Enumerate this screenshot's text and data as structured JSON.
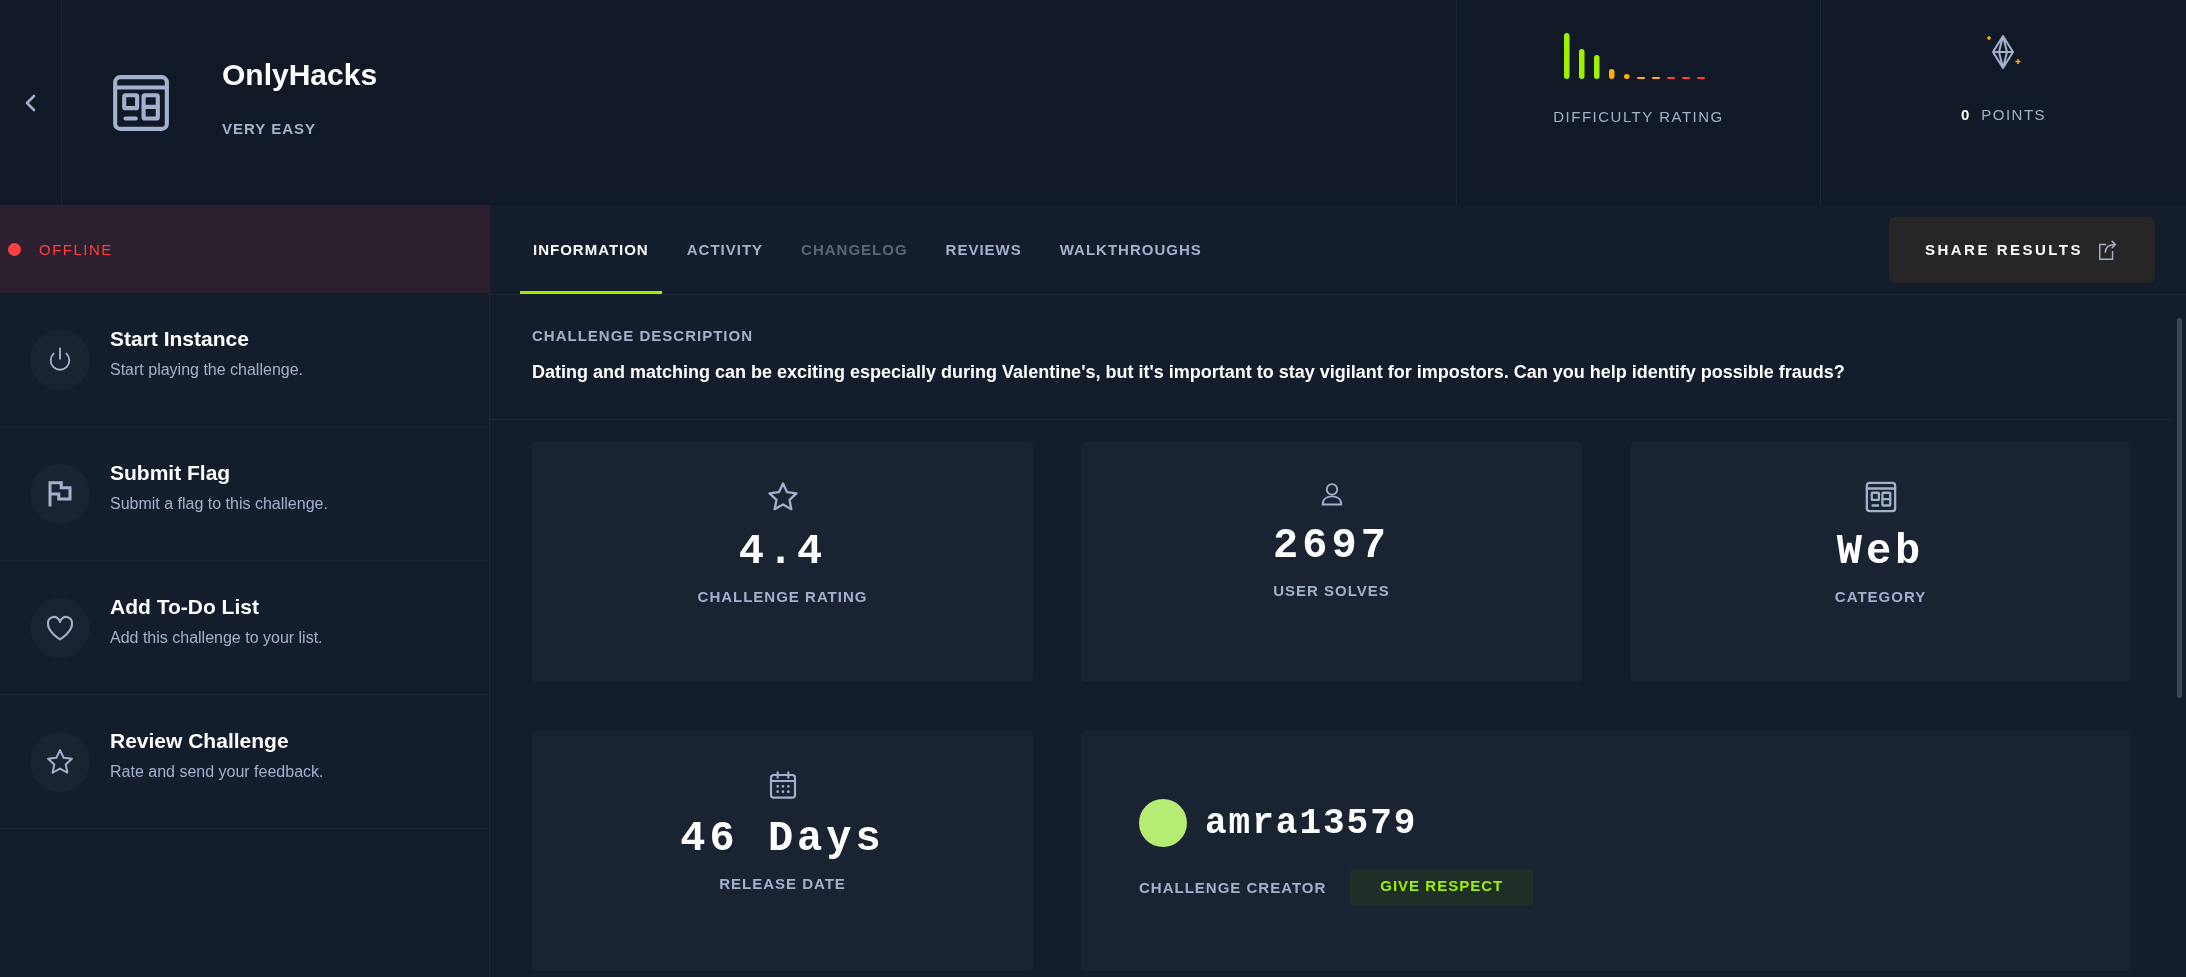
{
  "header": {
    "title": "OnlyHacks",
    "difficulty": "VERY EASY",
    "difficulty_label": "DIFFICULTY RATING",
    "points_value": "0",
    "points_label": "POINTS"
  },
  "status": {
    "label": "OFFLINE",
    "online": false
  },
  "actions": [
    {
      "title": "Start Instance",
      "description": "Start playing the challenge."
    },
    {
      "title": "Submit Flag",
      "description": "Submit a flag to this challenge."
    },
    {
      "title": "Add To-Do List",
      "description": "Add this challenge to your list."
    },
    {
      "title": "Review Challenge",
      "description": "Rate and send your feedback."
    }
  ],
  "tabs": [
    {
      "label": "INFORMATION",
      "selected": true,
      "disabled": false
    },
    {
      "label": "ACTIVITY",
      "selected": false,
      "disabled": false
    },
    {
      "label": "CHANGELOG",
      "selected": false,
      "disabled": true
    },
    {
      "label": "REVIEWS",
      "selected": false,
      "disabled": false
    },
    {
      "label": "WALKTHROUGHS",
      "selected": false,
      "disabled": false
    }
  ],
  "share_button": "SHARE RESULTS",
  "description": {
    "heading": "CHALLENGE DESCRIPTION",
    "text": "Dating and matching can be exciting especially during Valentine's, but it's important to stay vigilant for impostors. Can you help identify possible frauds?"
  },
  "stats": [
    {
      "value": "4.4",
      "label": "CHALLENGE RATING"
    },
    {
      "value": "2697",
      "label": "USER SOLVES"
    },
    {
      "value": "Web",
      "label": "CATEGORY"
    },
    {
      "value": "46 Days",
      "label": "RELEASE DATE"
    }
  ],
  "creator": {
    "name": "amra13579",
    "label": "CHALLENGE CREATOR",
    "button": "GIVE RESPECT"
  }
}
